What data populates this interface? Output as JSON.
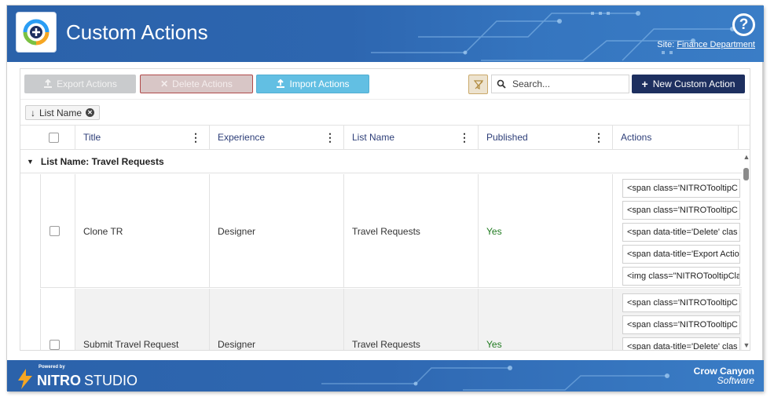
{
  "header": {
    "title": "Custom Actions",
    "help_icon": "question-circle-icon",
    "site_prefix": "Site:",
    "site_name": "Finance Department"
  },
  "toolbar": {
    "export_label": "Export Actions",
    "delete_label": "Delete Actions",
    "import_label": "Import Actions",
    "search_placeholder": "Search...",
    "new_label": "New Custom Action"
  },
  "grouping": {
    "chip_label": "List Name"
  },
  "grid": {
    "columns": [
      "Title",
      "Experience",
      "List Name",
      "Published",
      "Actions"
    ],
    "group_header": "List Name: Travel Requests",
    "rows": [
      {
        "title": "Clone TR",
        "experience": "Designer",
        "list_name": "Travel Requests",
        "published": "Yes",
        "actions": [
          "<span class='NITROTooltipC",
          "<span class='NITROTooltipC",
          "<span data-title='Delete' clas",
          "<span data-title='Export Actio",
          "<img class=\"NITROTooltipCla"
        ]
      },
      {
        "title": "Submit Travel Request",
        "experience": "Designer",
        "list_name": "Travel Requests",
        "published": "Yes",
        "actions": [
          "<span class='NITROTooltipC",
          "<span class='NITROTooltipC",
          "<span data-title='Delete' clas"
        ]
      }
    ]
  },
  "footer": {
    "powered_by": "Powered by",
    "brand_bold": "NITRO",
    "brand_light": "STUDIO",
    "company_line1": "Crow Canyon",
    "company_line2": "Software"
  },
  "colors": {
    "header_blue": "#2a63ad",
    "new_button_navy": "#1d2f5f",
    "import_button_blue": "#62bfe3",
    "published_green": "#1f7a1f"
  }
}
